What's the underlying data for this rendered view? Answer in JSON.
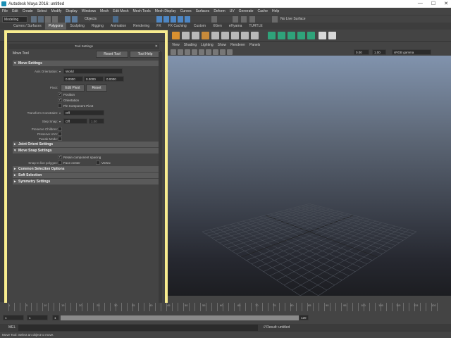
{
  "window": {
    "title": "Autodesk Maya 2016: untitled",
    "controls": [
      "—",
      "☐",
      "✕"
    ]
  },
  "menubar": [
    "File",
    "Edit",
    "Create",
    "Select",
    "Modify",
    "Display",
    "Windows",
    "Mesh",
    "Edit Mesh",
    "Mesh Tools",
    "Mesh Display",
    "Curves",
    "Surfaces",
    "Deform",
    "UV",
    "Generate",
    "Cache",
    "Help"
  ],
  "status": {
    "mode": "Modeling",
    "objects": "Objects",
    "live_surface": "No Live Surface"
  },
  "shelf_tabs": [
    "Curves / Surfaces",
    "Polygons",
    "Sculpting",
    "Rigging",
    "Animation",
    "Rendering",
    "FX",
    "FX Caching",
    "Custom",
    "XGen",
    "eHyama",
    "TURTLE"
  ],
  "shelf_active": "Polygons",
  "tool_settings": {
    "title": "Tool Settings",
    "tool_name": "Move Tool",
    "reset_label": "Reset Tool",
    "help_label": "Tool Help",
    "sections": {
      "move_settings": "Move Settings",
      "joint_orient": "Joint Orient Settings",
      "move_snap": "Move Snap Settings",
      "common_selection": "Common Selection Options",
      "soft_selection": "Soft Selection",
      "symmetry": "Symmetry Settings"
    },
    "axis_orientation_label": "Axis Orientation:",
    "axis_orientation_value": "World",
    "axis_values": [
      "0.0000",
      "0.0000",
      "0.0000"
    ],
    "pivot_label": "Pivot:",
    "edit_pivot_label": "Edit Pivot",
    "reset_pivot_label": "Reset",
    "position_label": "Position",
    "orientation_label": "Orientation",
    "pin_component_label": "Pin Component Pivot",
    "transform_constraint_label": "Transform Constraint:",
    "transform_constraint_value": "Off",
    "step_snap_label": "Step Snap:",
    "step_snap_value": "Off",
    "step_snap_amount": "1.00",
    "preserve_children_label": "Preserve Children:",
    "preserve_uvs_label": "Preserve UVs:",
    "tweak_mode_label": "Tweak Mode:",
    "retain_spacing_label": "Retain component spacing",
    "snap_polygon_label": "Snap to live polygon:",
    "face_center_label": "Face center",
    "vertex_label": "Vertex"
  },
  "viewport": {
    "menus": [
      "View",
      "Shading",
      "Lighting",
      "Show",
      "Renderer",
      "Panels"
    ],
    "field_a": "0.00",
    "field_b": "1.00",
    "color_space": "sRGB gamma",
    "camera": "persp"
  },
  "timeline": {
    "ticks": [
      "1",
      "5",
      "10",
      "15",
      "20",
      "25",
      "30",
      "35",
      "40",
      "45",
      "50",
      "55",
      "60",
      "65",
      "70",
      "75",
      "80",
      "85",
      "90",
      "95",
      "100",
      "105",
      "110",
      "115",
      "120"
    ],
    "start": "1",
    "current": "1",
    "range_start": "1",
    "range_end": "120"
  },
  "command_line": {
    "label": "MEL",
    "result": "// Result: untitled"
  },
  "help_line": "Move Tool: Select an object to move."
}
